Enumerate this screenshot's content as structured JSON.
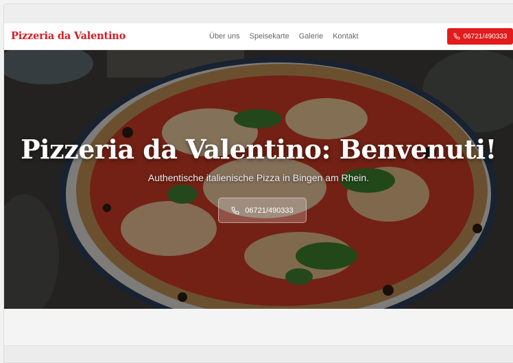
{
  "site": {
    "brand": "Pizzeria da Valentino",
    "nav": [
      {
        "label": "Über uns"
      },
      {
        "label": "Speisekarte"
      },
      {
        "label": "Galerie"
      },
      {
        "label": "Kontakt"
      }
    ],
    "phone_label": "06721/490333"
  },
  "hero": {
    "title": "Pizzeria da Valentino: Benvenuti!",
    "subtitle": "Authentische italienische Pizza in Bingen am Rhein.",
    "cta_label": "06721/490333",
    "image": "pizza-margherita-photo"
  },
  "colors": {
    "brand_red": "#d81b23",
    "button_red": "#e31b1b",
    "nav_text": "#666666"
  },
  "icons": {
    "phone": "phone-icon"
  }
}
